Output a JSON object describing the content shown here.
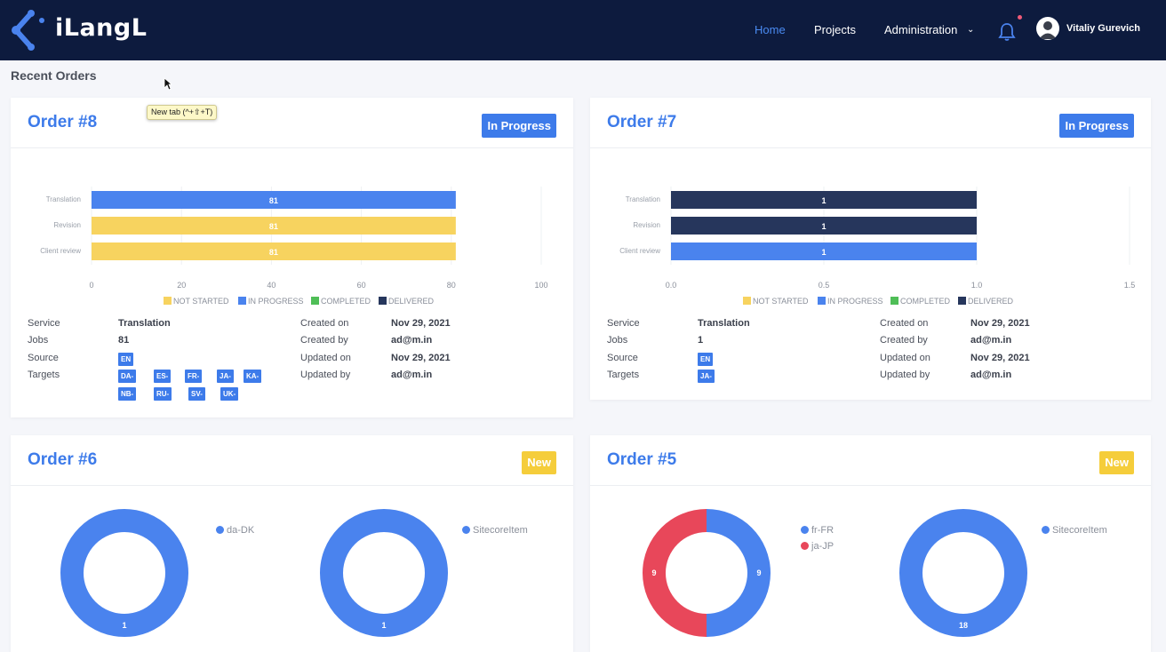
{
  "app": {
    "logo_text": "iLangL",
    "nav": [
      {
        "label": "Home"
      },
      {
        "label": "Projects"
      },
      {
        "label": "Administration"
      }
    ],
    "user_name": "Vitaliy Gurevich"
  },
  "page": {
    "section_title": "Recent Orders",
    "tooltip": "New tab (^+⇧+T)"
  },
  "colors": {
    "not_started": "#f7d35f",
    "in_progress": "#4a83ee",
    "completed": "#4fbe57",
    "delivered": "#26365c"
  },
  "legend": [
    "NOT STARTED",
    "IN PROGRESS",
    "COMPLETED",
    "DELIVERED"
  ],
  "detail_labels": {
    "service": "Service",
    "jobs": "Jobs",
    "source": "Source",
    "targets": "Targets",
    "created_on": "Created on",
    "created_by": "Created by",
    "updated_on": "Updated on",
    "updated_by": "Updated by"
  },
  "orders": [
    {
      "title": "Order #8",
      "status": "In Progress",
      "service": "Translation",
      "jobs": "81",
      "source": "EN",
      "targets": [
        "DA-DK",
        "ES-ES",
        "FR-FR",
        "JA-JP",
        "KA-GE",
        "NB-NO",
        "RU-RU",
        "SV-SE",
        "UK-UA"
      ],
      "created_on": "Nov 29, 2021",
      "created_by": "ad@m.in",
      "updated_on": "Nov 29, 2021",
      "updated_by": "ad@m.in"
    },
    {
      "title": "Order #7",
      "status": "In Progress",
      "service": "Translation",
      "jobs": "1",
      "source": "EN",
      "targets": [
        "JA-JP"
      ],
      "created_on": "Nov 29, 2021",
      "created_by": "ad@m.in",
      "updated_on": "Nov 29, 2021",
      "updated_by": "ad@m.in"
    },
    {
      "title": "Order #6",
      "status": "New"
    },
    {
      "title": "Order #5",
      "status": "New"
    }
  ],
  "chart_data": [
    {
      "type": "bar",
      "orientation": "horizontal",
      "categories": [
        "Translation",
        "Revision",
        "Client review"
      ],
      "values": [
        81,
        81,
        81
      ],
      "bar_status": [
        "IN PROGRESS",
        "NOT STARTED",
        "NOT STARTED"
      ],
      "xlim": [
        0,
        100
      ],
      "ticks": [
        "0",
        "20",
        "40",
        "60",
        "80",
        "100"
      ],
      "legend": [
        "NOT STARTED",
        "IN PROGRESS",
        "COMPLETED",
        "DELIVERED"
      ]
    },
    {
      "type": "bar",
      "orientation": "horizontal",
      "categories": [
        "Translation",
        "Revision",
        "Client review"
      ],
      "values": [
        1,
        1,
        1
      ],
      "bar_status": [
        "DELIVERED",
        "DELIVERED",
        "IN PROGRESS"
      ],
      "xlim": [
        0,
        1.5
      ],
      "ticks": [
        "0.0",
        "0.5",
        "1.0",
        "1.5"
      ],
      "legend": [
        "NOT STARTED",
        "IN PROGRESS",
        "COMPLETED",
        "DELIVERED"
      ]
    },
    {
      "type": "pie",
      "donut": true,
      "labels": [
        "da-DK"
      ],
      "values": [
        1
      ],
      "colors": [
        "#4a83ee"
      ]
    },
    {
      "type": "pie",
      "donut": true,
      "labels": [
        "SitecoreItem"
      ],
      "values": [
        1
      ],
      "colors": [
        "#4a83ee"
      ]
    },
    {
      "type": "pie",
      "donut": true,
      "labels": [
        "fr-FR",
        "ja-JP"
      ],
      "values": [
        9,
        9
      ],
      "colors": [
        "#4a83ee",
        "#e8475a"
      ]
    },
    {
      "type": "pie",
      "donut": true,
      "labels": [
        "SitecoreItem"
      ],
      "values": [
        18
      ],
      "colors": [
        "#4a83ee"
      ]
    }
  ]
}
